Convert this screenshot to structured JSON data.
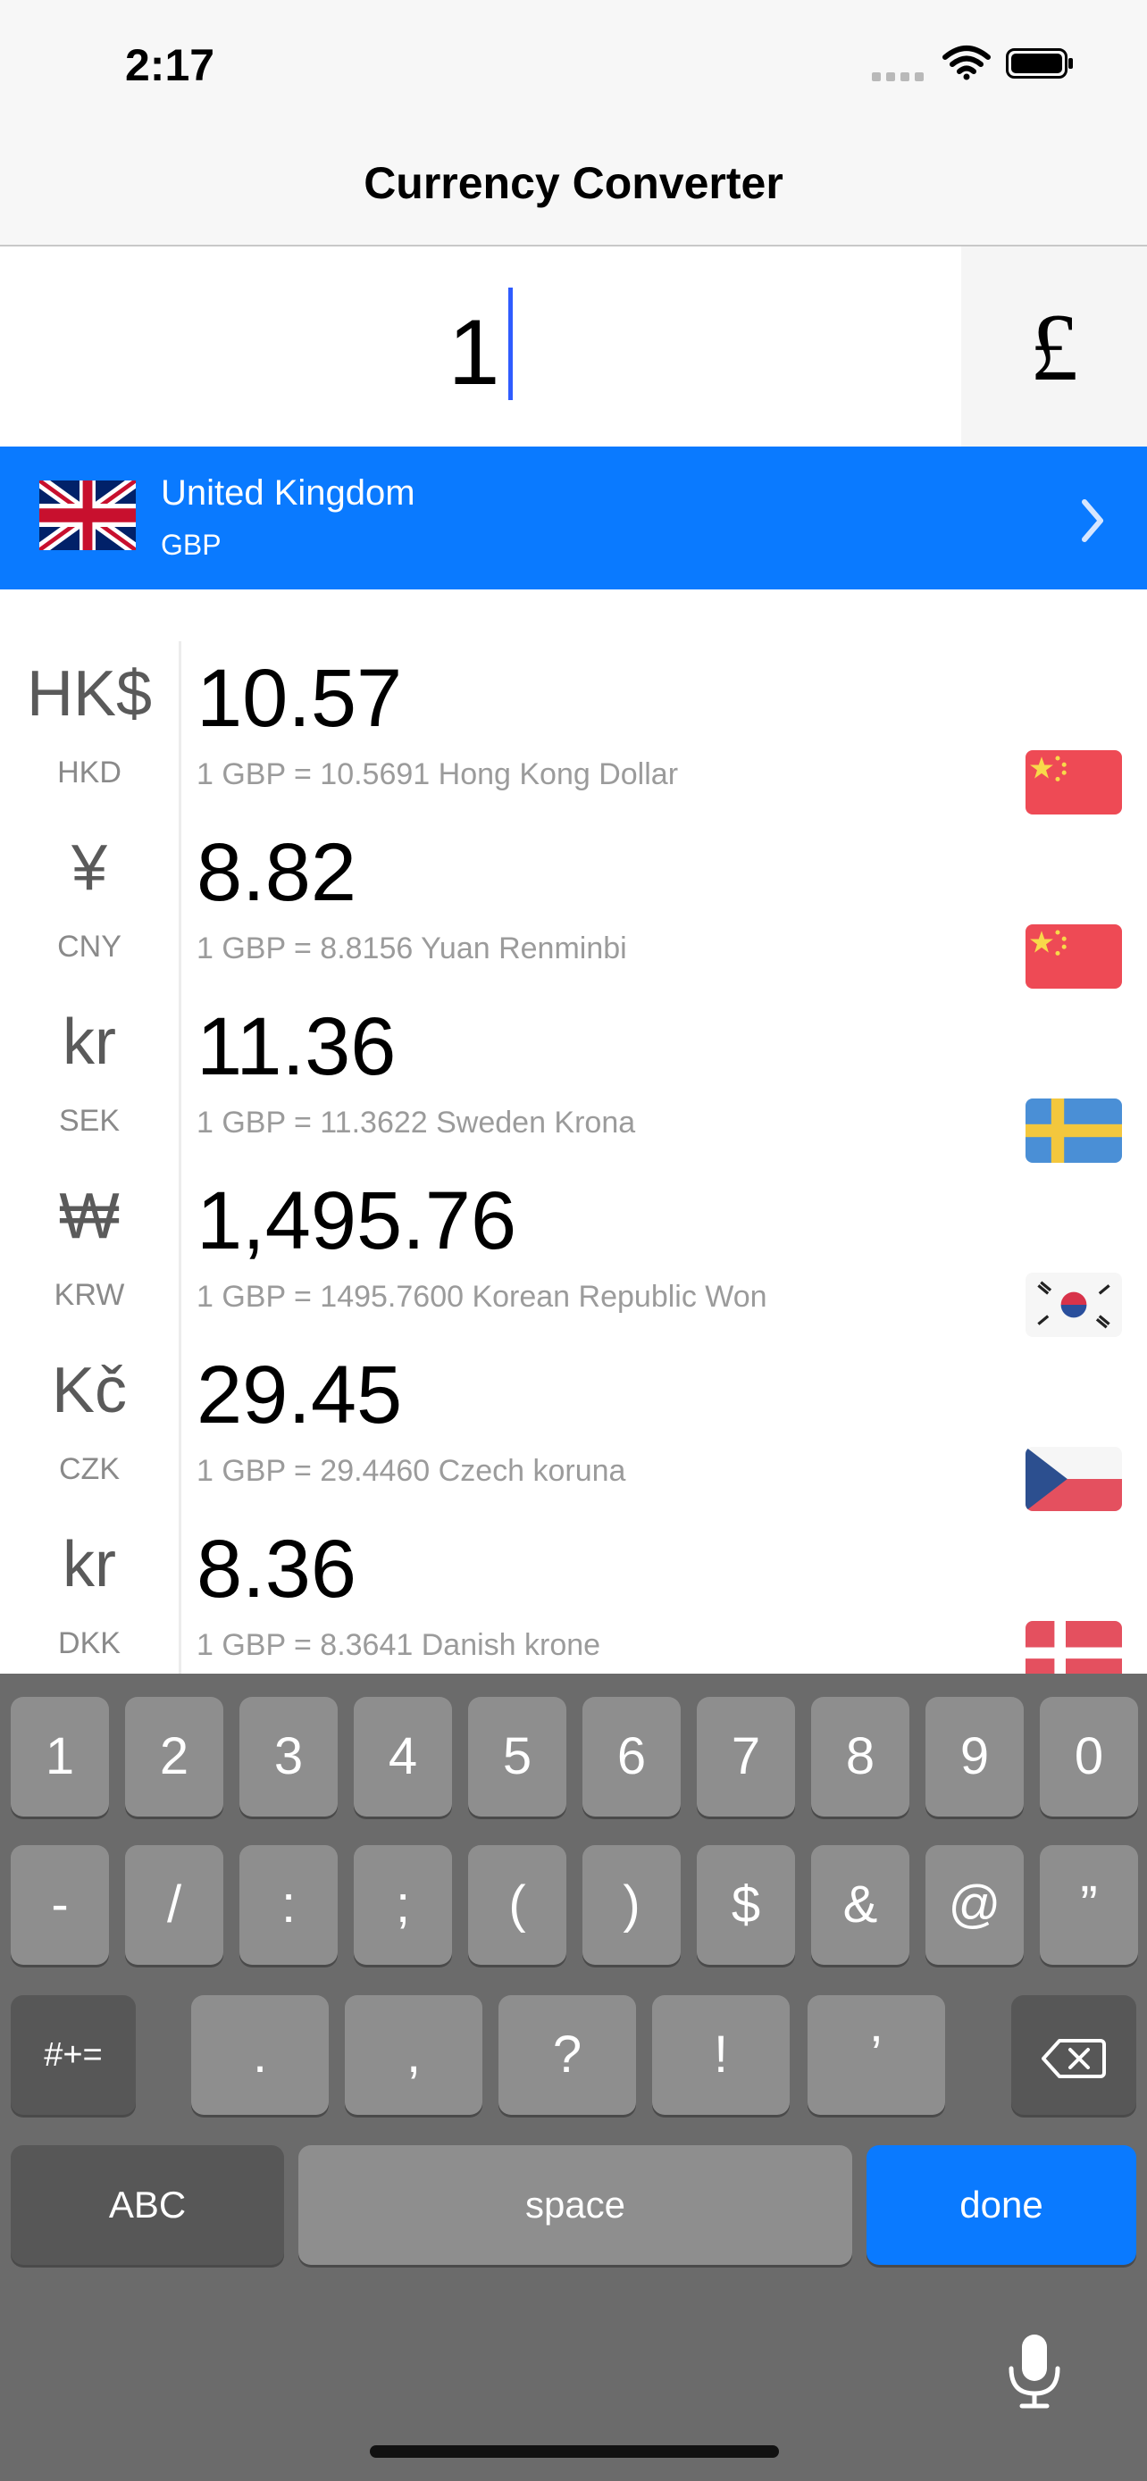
{
  "status_bar": {
    "time": "2:17"
  },
  "nav": {
    "title": "Currency Converter"
  },
  "amount": {
    "value": "1",
    "symbol": "£"
  },
  "base": {
    "country": "United Kingdom",
    "code": "GBP"
  },
  "rows": [
    {
      "symbol": "HK$",
      "code": "HKD",
      "amount": "10.57",
      "rate": "1 GBP = 10.5691 Hong Kong Dollar",
      "flag": "china-flag-icon"
    },
    {
      "symbol": "¥",
      "code": "CNY",
      "amount": "8.82",
      "rate": "1 GBP = 8.8156 Yuan Renminbi",
      "flag": "china-flag-icon"
    },
    {
      "symbol": "kr",
      "code": "SEK",
      "amount": "11.36",
      "rate": "1 GBP = 11.3622 Sweden Krona",
      "flag": "sweden-flag-icon"
    },
    {
      "symbol": "₩",
      "code": "KRW",
      "amount": "1,495.76",
      "rate": "1 GBP = 1495.7600 Korean Republic Won",
      "flag": "korea-flag-icon"
    },
    {
      "symbol": "Kč",
      "code": "CZK",
      "amount": "29.45",
      "rate": "1 GBP = 29.4460 Czech koruna",
      "flag": "czech-flag-icon"
    },
    {
      "symbol": "kr",
      "code": "DKK",
      "amount": "8.36",
      "rate": "1 GBP = 8.3641 Danish krone",
      "flag": "denmark-flag-icon"
    }
  ],
  "keyboard": {
    "row1": [
      "1",
      "2",
      "3",
      "4",
      "5",
      "6",
      "7",
      "8",
      "9",
      "0"
    ],
    "row2": [
      "-",
      "/",
      ":",
      ";",
      "(",
      ")",
      "$",
      "&",
      "@",
      "”"
    ],
    "symbols_key": "#+=",
    "row3": [
      ".",
      ",",
      "?",
      "!",
      "’"
    ],
    "abc": "ABC",
    "space": "space",
    "done": "done"
  },
  "colors": {
    "accent": "#0a7aff",
    "caret": "#2f5cff"
  }
}
